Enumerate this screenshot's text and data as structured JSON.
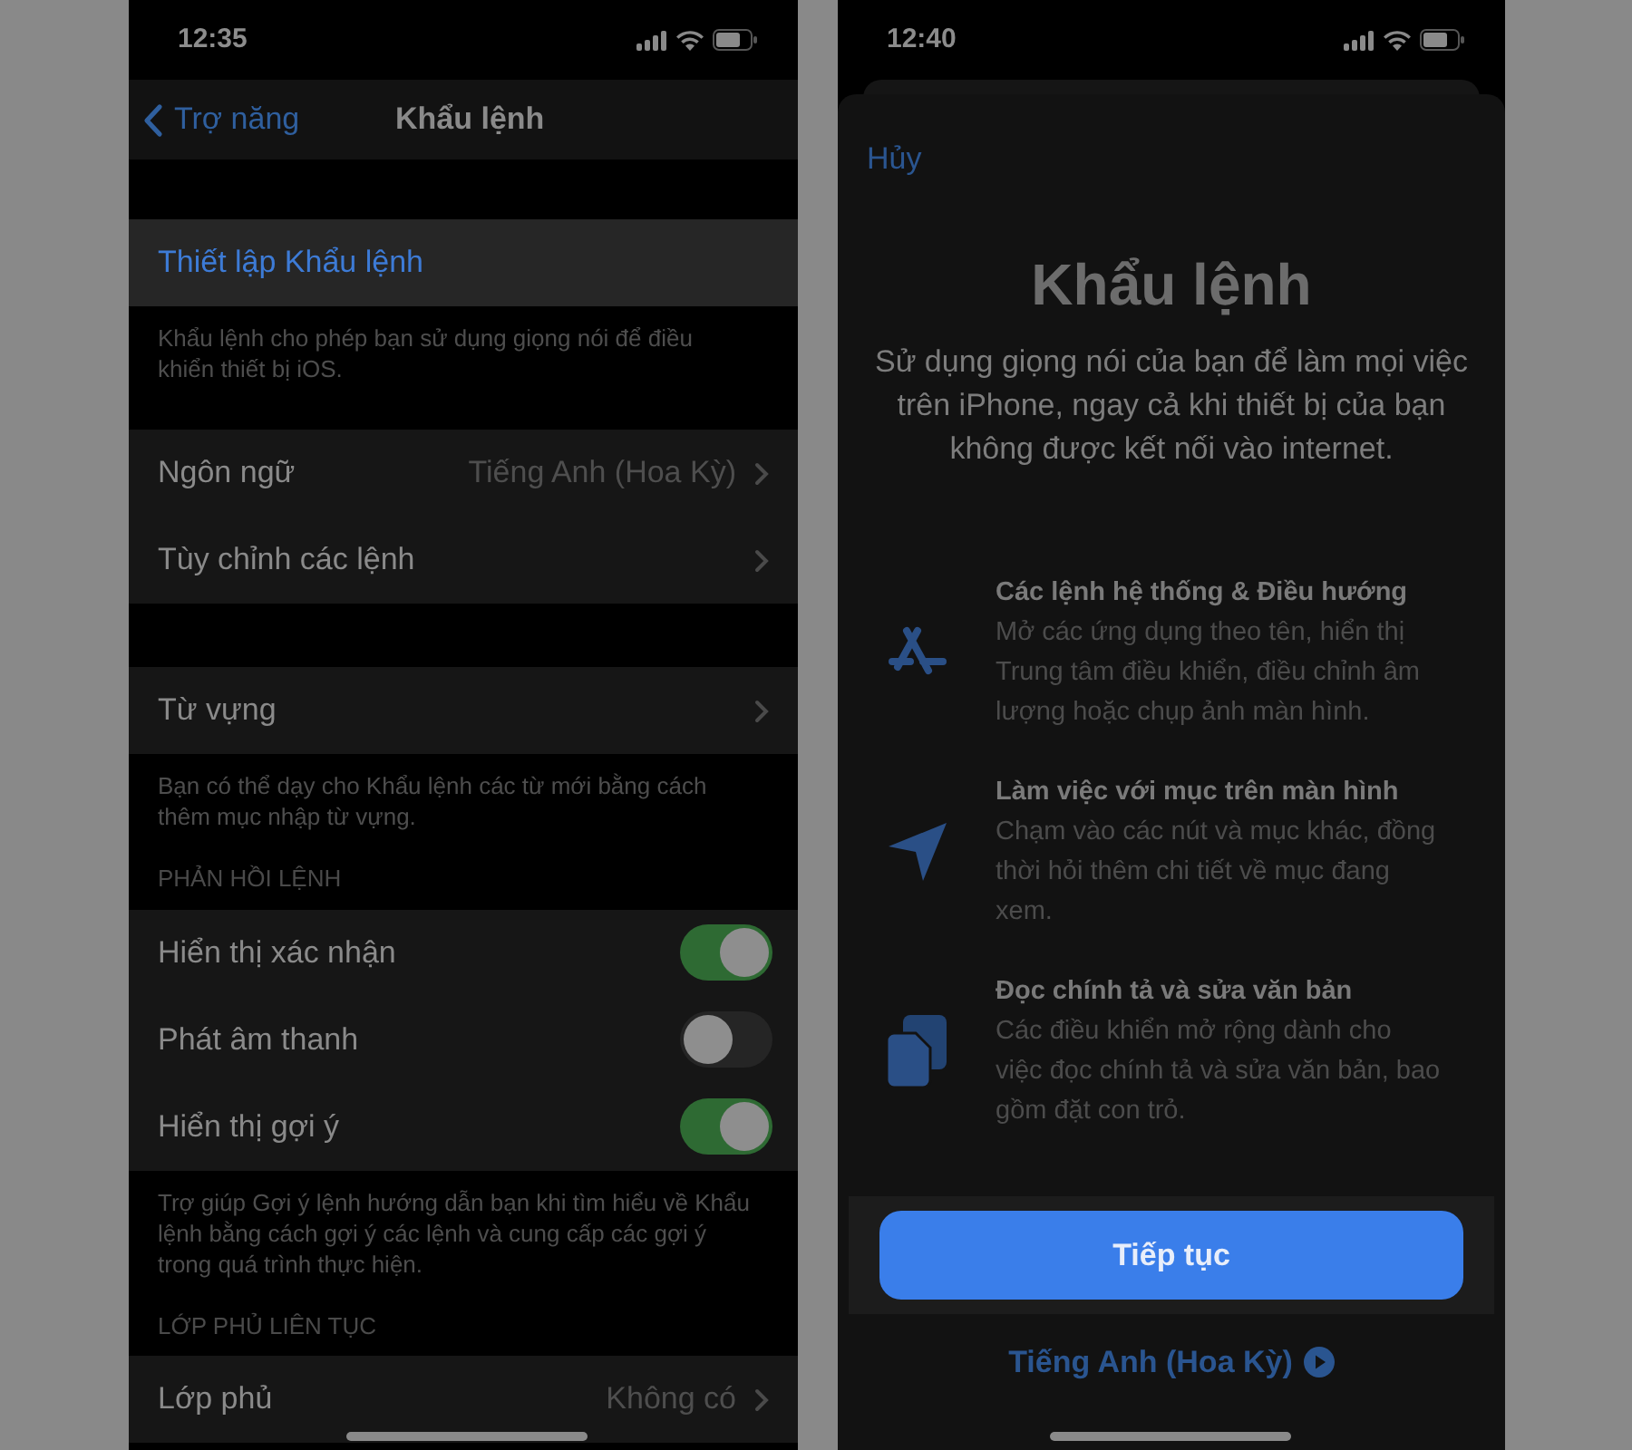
{
  "settings_screen": {
    "status_bar": {
      "time": "12:35"
    },
    "nav": {
      "back": "Trợ năng",
      "title": "Khẩu lệnh"
    },
    "sections": [
      {
        "rows": [
          {
            "kind": "action",
            "label": "Thiết lập Khẩu lệnh",
            "selected": true
          }
        ],
        "footer": "Khẩu lệnh cho phép bạn sử dụng giọng nói để điều khiển thiết bị iOS."
      },
      {
        "rows": [
          {
            "kind": "link",
            "label": "Ngôn ngữ",
            "value": "Tiếng Anh (Hoa Kỳ)"
          },
          {
            "kind": "link",
            "label": "Tùy chỉnh các lệnh"
          }
        ]
      },
      {
        "rows": [
          {
            "kind": "link",
            "label": "Từ vựng"
          }
        ],
        "footer": "Bạn có thể dạy cho Khẩu lệnh các từ mới bằng cách thêm mục nhập từ vựng."
      },
      {
        "header": "PHẢN HỒI LỆNH",
        "rows": [
          {
            "kind": "toggle",
            "label": "Hiển thị xác nhận",
            "on": true
          },
          {
            "kind": "toggle",
            "label": "Phát âm thanh",
            "on": false
          },
          {
            "kind": "toggle",
            "label": "Hiển thị gợi ý",
            "on": true
          }
        ],
        "footer": "Trợ giúp Gợi ý lệnh hướng dẫn bạn khi tìm hiểu về Khẩu lệnh bằng cách gợi ý các lệnh và cung cấp các gợi ý trong quá trình thực hiện."
      },
      {
        "header": "LỚP PHỦ LIÊN TỤC",
        "rows": [
          {
            "kind": "link",
            "label": "Lớp phủ",
            "value": "Không có"
          }
        ]
      }
    ]
  },
  "intro_screen": {
    "status_bar": {
      "time": "12:40"
    },
    "cancel": "Hủy",
    "title": "Khẩu lệnh",
    "description": "Sử dụng giọng nói của bạn để làm mọi việc trên iPhone, ngay cả khi thiết bị của bạn không được kết nối vào internet.",
    "features": [
      {
        "title": "Các lệnh hệ thống & Điều hướng",
        "text": "Mở các ứng dụng theo tên, hiển thị Trung tâm điều khiển, điều chỉnh âm lượng hoặc chụp ảnh màn hình."
      },
      {
        "title": "Làm việc với mục trên màn hình",
        "text": "Chạm vào các nút và mục khác, đồng thời hỏi thêm chi tiết về mục đang xem."
      },
      {
        "title": "Đọc chính tả và sửa văn bản",
        "text": "Các điều khiển mở rộng dành cho việc đọc chính tả và sửa văn bản, bao gồm đặt con trỏ."
      }
    ],
    "continue_button": "Tiếp tục",
    "language_link": "Tiếng Anh (Hoa Kỳ)"
  }
}
